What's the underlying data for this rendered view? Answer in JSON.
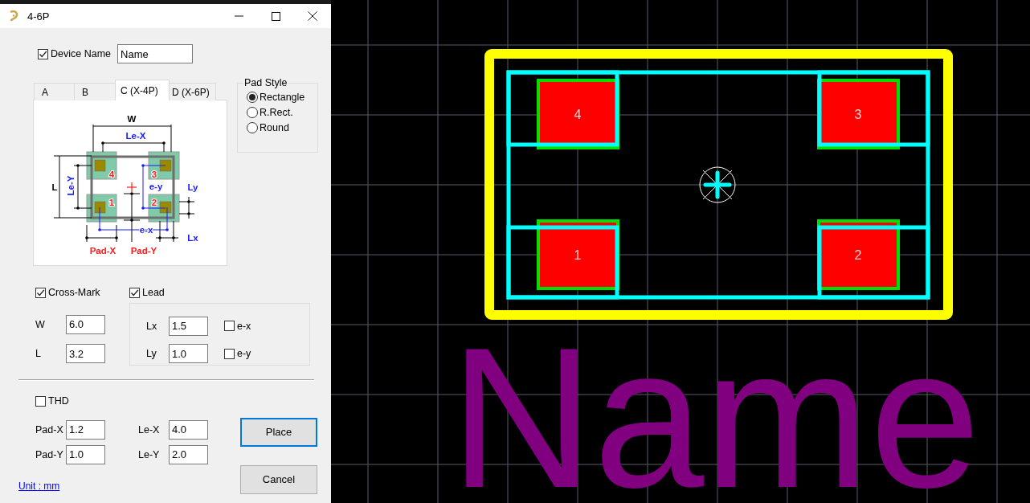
{
  "window": {
    "title": "4-6P"
  },
  "device_name": {
    "label": "Device Name",
    "checked": true,
    "value": "Name"
  },
  "tabs": [
    {
      "label": "A",
      "selected": false
    },
    {
      "label": "B",
      "selected": false
    },
    {
      "label": "C (X-4P)",
      "selected": true
    },
    {
      "label": "D (X-6P)",
      "selected": false
    }
  ],
  "diagram_labels": [
    {
      "text": "W",
      "kind": "body"
    },
    {
      "text": "Le-X",
      "kind": "lead"
    },
    {
      "text": "4",
      "kind": "pad"
    },
    {
      "text": "3",
      "kind": "pad"
    },
    {
      "text": "Le-Y",
      "kind": "lead"
    },
    {
      "text": "L",
      "kind": "body"
    },
    {
      "text": "e-y",
      "kind": "lead"
    },
    {
      "text": "Ly",
      "kind": "lead"
    },
    {
      "text": "1",
      "kind": "pad"
    },
    {
      "text": "2",
      "kind": "pad"
    },
    {
      "text": "e-x",
      "kind": "lead"
    },
    {
      "text": "Lx",
      "kind": "lead"
    },
    {
      "text": "Pad-X",
      "kind": "pad"
    },
    {
      "text": "Pad-Y",
      "kind": "pad"
    }
  ],
  "pad_style": {
    "title": "Pad Style",
    "options": [
      {
        "label": "Rectangle",
        "selected": true
      },
      {
        "label": "R.Rect.",
        "selected": false
      },
      {
        "label": "Round",
        "selected": false
      }
    ]
  },
  "cross_mark": {
    "label": "Cross-Mark",
    "checked": true
  },
  "lead": {
    "label": "Lead",
    "checked": true
  },
  "size_fields": [
    {
      "label": "W",
      "value": "6.0"
    },
    {
      "label": "L",
      "value": "3.2"
    }
  ],
  "lead_fields": [
    {
      "label": "Lx",
      "value": "1.5",
      "option": {
        "label": "e-x",
        "checked": false
      }
    },
    {
      "label": "Ly",
      "value": "1.0",
      "option": {
        "label": "e-y",
        "checked": false
      }
    }
  ],
  "thd": {
    "label": "THD",
    "checked": false
  },
  "pad_fields": [
    {
      "label": "Pad-X",
      "value": "1.2"
    },
    {
      "label": "Pad-Y",
      "value": "1.0"
    }
  ],
  "le_fields": [
    {
      "label": "Le-X",
      "value": "4.0"
    },
    {
      "label": "Le-Y",
      "value": "2.0"
    }
  ],
  "buttons": [
    {
      "label": "Place",
      "kind": "default"
    },
    {
      "label": "Cancel",
      "kind": "normal"
    }
  ],
  "unit_link": "Unit : mm",
  "canvas": {
    "pads": [
      {
        "number": "4"
      },
      {
        "number": "3"
      },
      {
        "number": "1"
      },
      {
        "number": "2"
      }
    ],
    "device_name": "Name"
  }
}
